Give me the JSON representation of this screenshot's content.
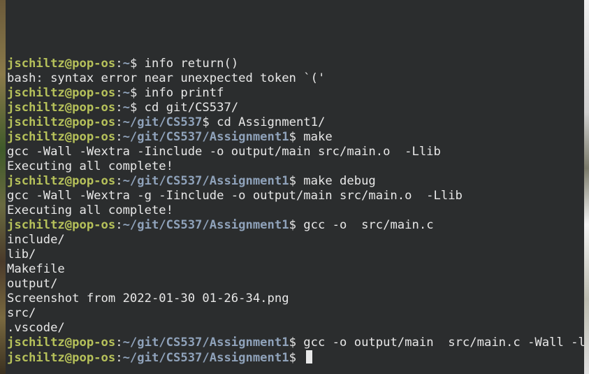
{
  "terminal": {
    "prompt_user_host": "jschiltz@pop-os",
    "lines": [
      {
        "type": "prompt",
        "path": "~",
        "command": " info return()"
      },
      {
        "type": "output",
        "text": "bash: syntax error near unexpected token `('"
      },
      {
        "type": "prompt",
        "path": "~",
        "command": " info printf"
      },
      {
        "type": "prompt",
        "path": "~",
        "command": " cd git/CS537/"
      },
      {
        "type": "prompt",
        "path": "~/git/CS537",
        "command": " cd Assignment1/"
      },
      {
        "type": "prompt",
        "path": "~/git/CS537/Assignment1",
        "command": " make"
      },
      {
        "type": "output",
        "text": "gcc -Wall -Wextra -Iinclude -o output/main src/main.o  -Llib"
      },
      {
        "type": "output",
        "text": "Executing all complete!"
      },
      {
        "type": "prompt",
        "path": "~/git/CS537/Assignment1",
        "command": " make debug"
      },
      {
        "type": "output",
        "text": "gcc -Wall -Wextra -g -Iinclude -o output/main src/main.o  -Llib"
      },
      {
        "type": "output",
        "text": "Executing all complete!"
      },
      {
        "type": "prompt",
        "path": "~/git/CS537/Assignment1",
        "command": " gcc -o  src/main.c"
      },
      {
        "type": "output",
        "text": "include/"
      },
      {
        "type": "output",
        "text": "lib/"
      },
      {
        "type": "output",
        "text": "Makefile"
      },
      {
        "type": "output",
        "text": "output/"
      },
      {
        "type": "output",
        "text": "Screenshot from 2022-01-30 01-26-34.png"
      },
      {
        "type": "output",
        "text": "src/"
      },
      {
        "type": "output",
        "text": ".vscode/"
      },
      {
        "type": "prompt",
        "path": "~/git/CS537/Assignment1",
        "command": " gcc -o output/main  src/main.c -Wall -lm"
      },
      {
        "type": "prompt",
        "path": "~/git/CS537/Assignment1",
        "command": " ",
        "cursor": true
      }
    ]
  },
  "colors": {
    "background": "#2b2d2e",
    "user": "#b6c15a",
    "path": "#8fa2ba",
    "text": "#e8e8e8"
  }
}
